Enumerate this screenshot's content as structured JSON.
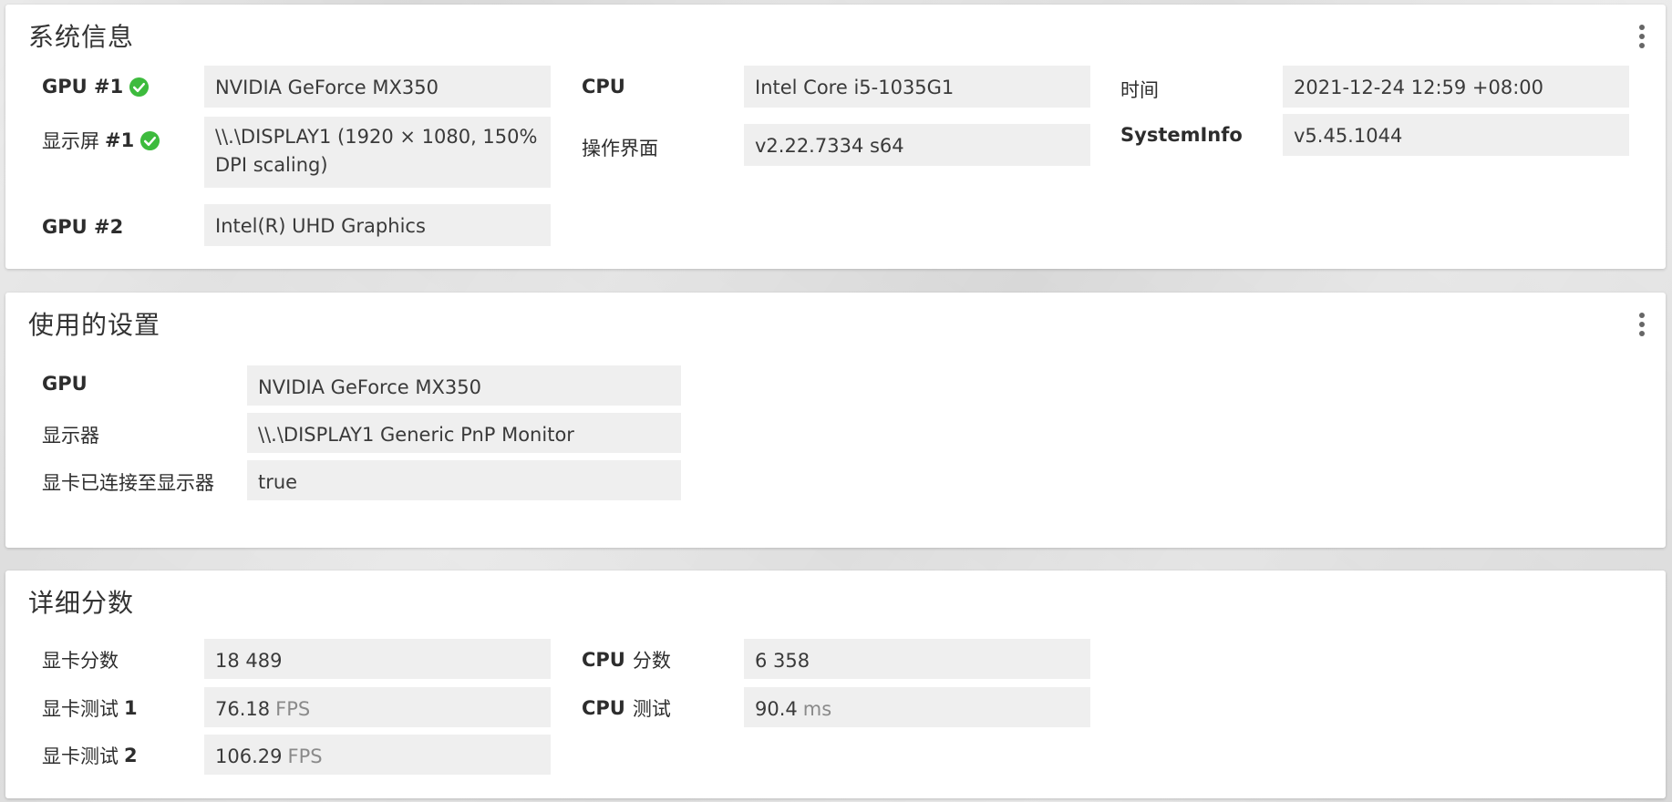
{
  "colors": {
    "check_green": "#3dbb3d",
    "value_bg": "#efefef",
    "panel_bg": "#ffffff"
  },
  "system_info": {
    "title": "系统信息",
    "gpu1_label": "GPU #1",
    "gpu1_value": "NVIDIA GeForce MX350",
    "display1_label": "显示屏",
    "display1_num": "#1",
    "display1_value": "\\\\.\\DISPLAY1 (1920 × 1080, 150% DPI scaling)",
    "gpu2_label": "GPU #2",
    "gpu2_value": "Intel(R) UHD Graphics",
    "cpu_label": "CPU",
    "cpu_value": "Intel Core i5-1035G1",
    "ui_label": "操作界面",
    "ui_value": "v2.22.7334 s64",
    "time_label": "时间",
    "time_value": "2021-12-24 12:59 +08:00",
    "sysinfo_label": "SystemInfo",
    "sysinfo_value": "v5.45.1044"
  },
  "settings": {
    "title": "使用的设置",
    "gpu_label": "GPU",
    "gpu_value": "NVIDIA GeForce MX350",
    "display_label": "显示器",
    "display_value": "\\\\.\\DISPLAY1 Generic PnP Monitor",
    "connected_label": "显卡已连接至显示器",
    "connected_value": "true"
  },
  "scores": {
    "title": "详细分数",
    "gfx_score_label": "显卡分数",
    "gfx_score_value": "18 489",
    "gfx_test1_label": "显卡测试",
    "gfx_test1_num": "1",
    "gfx_test1_value": "76.18",
    "gfx_test1_unit": "FPS",
    "gfx_test2_label": "显卡测试",
    "gfx_test2_num": "2",
    "gfx_test2_value": "106.29",
    "gfx_test2_unit": "FPS",
    "cpu_score_prefix": "CPU",
    "cpu_score_label": "分数",
    "cpu_score_value": "6 358",
    "cpu_test_prefix": "CPU",
    "cpu_test_label": "测试",
    "cpu_test_value": "90.4",
    "cpu_test_unit": "ms"
  }
}
